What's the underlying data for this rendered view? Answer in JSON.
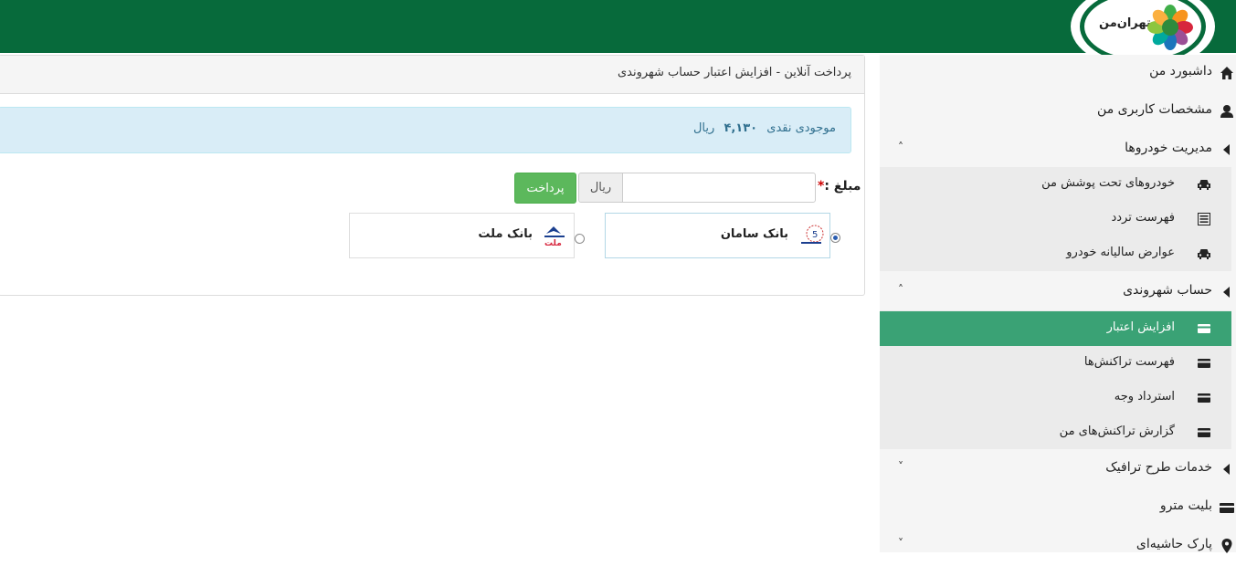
{
  "header": {
    "logo_text": "تهران‌من",
    "brand_color": "#076a3b"
  },
  "sidebar": {
    "items": [
      {
        "label": "داشبورد من",
        "icon": "home-icon"
      },
      {
        "label": "مشخصات کاربری من",
        "icon": "user-icon"
      },
      {
        "label": "مدیریت خودروها",
        "icon": "caret-left-icon",
        "chevron": "˄"
      },
      {
        "label": "حساب شهروندی",
        "icon": "caret-left-icon",
        "chevron": "˄"
      },
      {
        "label": "خدمات طرح ترافیک",
        "icon": "caret-left-icon",
        "chevron": "˅"
      },
      {
        "label": "بلیت مترو",
        "icon": "card-icon"
      },
      {
        "label": "پارک حاشیه‌ای",
        "icon": "map-pin-icon",
        "chevron": "˅"
      }
    ],
    "vehicle_sub": [
      {
        "label": "خودروهای تحت پوشش من",
        "icon": "car-icon"
      },
      {
        "label": "فهرست تردد",
        "icon": "list-icon"
      },
      {
        "label": "عوارض سالیانه خودرو",
        "icon": "car-icon"
      }
    ],
    "account_sub": [
      {
        "label": "افزایش اعتبار",
        "icon": "card-icon",
        "active": true
      },
      {
        "label": "فهرست تراکنش‌ها",
        "icon": "card-icon"
      },
      {
        "label": "استرداد وجه",
        "icon": "card-icon"
      },
      {
        "label": "گزارش تراکنش‌های من",
        "icon": "card-icon"
      }
    ],
    "active_color": "#3aa275"
  },
  "main": {
    "panel_title": "پرداخت آنلاین - افزایش اعتبار حساب شهروندی",
    "balance": {
      "label": "موجودی نقدی",
      "amount": "۴,۱۳۰",
      "unit": "ریال"
    },
    "amount_label": "مبلغ :",
    "amount_required": "*",
    "amount_value": "",
    "amount_placeholder": "",
    "currency_addon": "ریال",
    "pay_button": "پرداخت",
    "banks": [
      {
        "name": "بانک سامان",
        "selected": true
      },
      {
        "name": "بانک ملت",
        "selected": false
      }
    ],
    "mellat_logo_text": "ملت"
  }
}
